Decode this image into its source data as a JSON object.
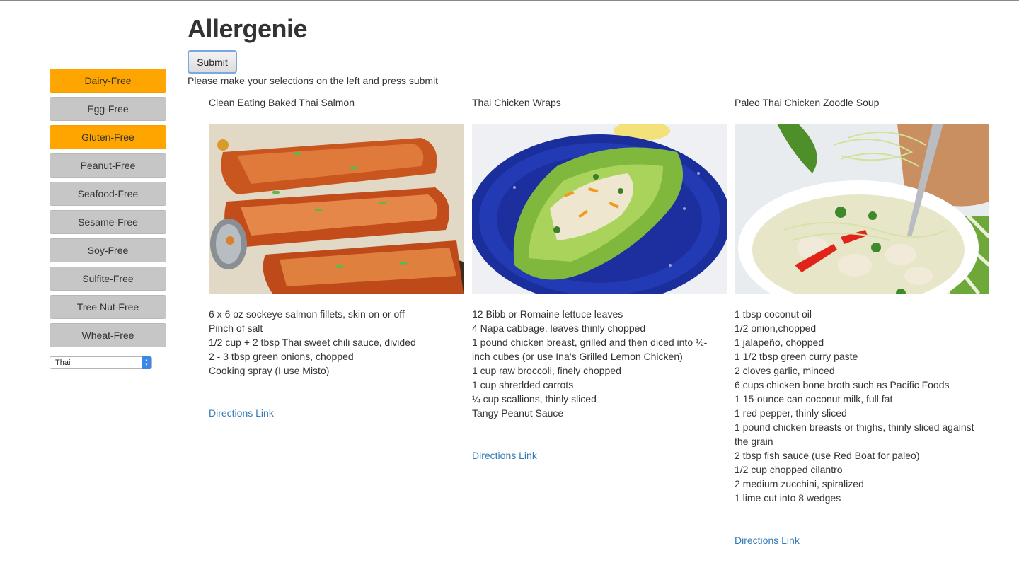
{
  "app": {
    "title": "Allergenie"
  },
  "form": {
    "submit_label": "Submit",
    "instructions": "Please make your selections on the left and press submit"
  },
  "sidebar": {
    "filters": [
      {
        "label": "Dairy-Free",
        "selected": true
      },
      {
        "label": "Egg-Free",
        "selected": false
      },
      {
        "label": "Gluten-Free",
        "selected": true
      },
      {
        "label": "Peanut-Free",
        "selected": false
      },
      {
        "label": "Seafood-Free",
        "selected": false
      },
      {
        "label": "Sesame-Free",
        "selected": false
      },
      {
        "label": "Soy-Free",
        "selected": false
      },
      {
        "label": "Sulfite-Free",
        "selected": false
      },
      {
        "label": "Tree Nut-Free",
        "selected": false
      },
      {
        "label": "Wheat-Free",
        "selected": false
      }
    ],
    "cuisine": {
      "selected": "Thai"
    }
  },
  "colors": {
    "selected_filter": "#ffa500",
    "unselected_filter": "#c6c6c6",
    "link": "#337ab7"
  },
  "recipes": [
    {
      "title": "Clean Eating Baked Thai Salmon",
      "image_icon": "salmon-photo",
      "ingredients": [
        "6 x 6 oz sockeye salmon fillets, skin on or off",
        "Pinch of salt",
        "1/2 cup + 2 tbsp Thai sweet chili sauce, divided",
        "2 - 3 tbsp green onions, chopped",
        "Cooking spray (I use Misto)"
      ],
      "link_label": "Directions Link"
    },
    {
      "title": "Thai Chicken Wraps",
      "image_icon": "chicken-wraps-photo",
      "ingredients": [
        "12 Bibb or Romaine lettuce leaves",
        "4 Napa cabbage, leaves thinly chopped",
        "1 pound chicken breast, grilled and then diced into ½-inch cubes (or use Ina’s Grilled Lemon Chicken)",
        "1 cup raw broccoli, finely chopped",
        "1 cup shredded carrots",
        "¼ cup scallions, thinly sliced",
        "Tangy Peanut Sauce"
      ],
      "link_label": "Directions Link"
    },
    {
      "title": "Paleo Thai Chicken Zoodle Soup",
      "image_icon": "zoodle-soup-photo",
      "ingredients": [
        "1 tbsp coconut oil",
        "1/2 onion,chopped",
        "1 jalapeño, chopped",
        "1 1/2 tbsp green curry paste",
        "2 cloves garlic, minced",
        "6 cups chicken bone broth such as Pacific Foods",
        "1 15-ounce can coconut milk, full fat",
        "1 red pepper, thinly sliced",
        "1 pound chicken breasts or thighs, thinly sliced against the grain",
        "2 tbsp fish sauce (use Red Boat for paleo)",
        "1/2 cup chopped cilantro",
        "2 medium zucchini, spiralized",
        "1 lime cut into 8 wedges"
      ],
      "link_label": "Directions Link"
    }
  ]
}
